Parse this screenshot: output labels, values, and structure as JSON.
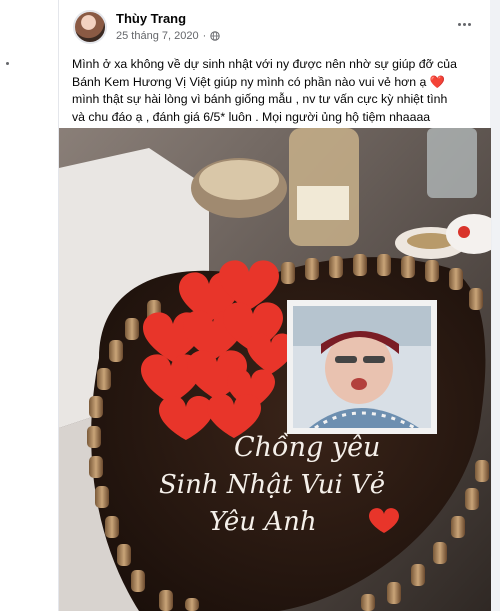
{
  "post": {
    "author": "Thùy Trang",
    "date": "25 tháng 7, 2020",
    "privacy_icon": "globe-icon",
    "more_icon": "more-options-icon",
    "caption_lines": [
      "Mình ở xa không về dự sinh nhật với ny được nên nhờ sự giúp đỡ của",
      "Bánh Kem Hương Vị Việt giúp ny mình có phần nào vui vẻ hơn ạ",
      "mình thật sự hài lòng vì bánh giống mẫu , nv tư vấn cực kỳ nhiệt tình",
      "và chu đáo ạ , đánh giá 6/5* luôn . Mọi người ủng hộ tiệm nhaaaa"
    ],
    "caption_heart": "❤️"
  },
  "cake": {
    "line1": "Chồng yêu",
    "line2": "Sinh Nhật Vui Vẻ",
    "line3": "Yêu Anh"
  },
  "colors": {
    "cake_heart_red": "#e8352a",
    "chocolate": "#2a1a14",
    "text_primary": "#050505",
    "text_secondary": "#65676b"
  }
}
